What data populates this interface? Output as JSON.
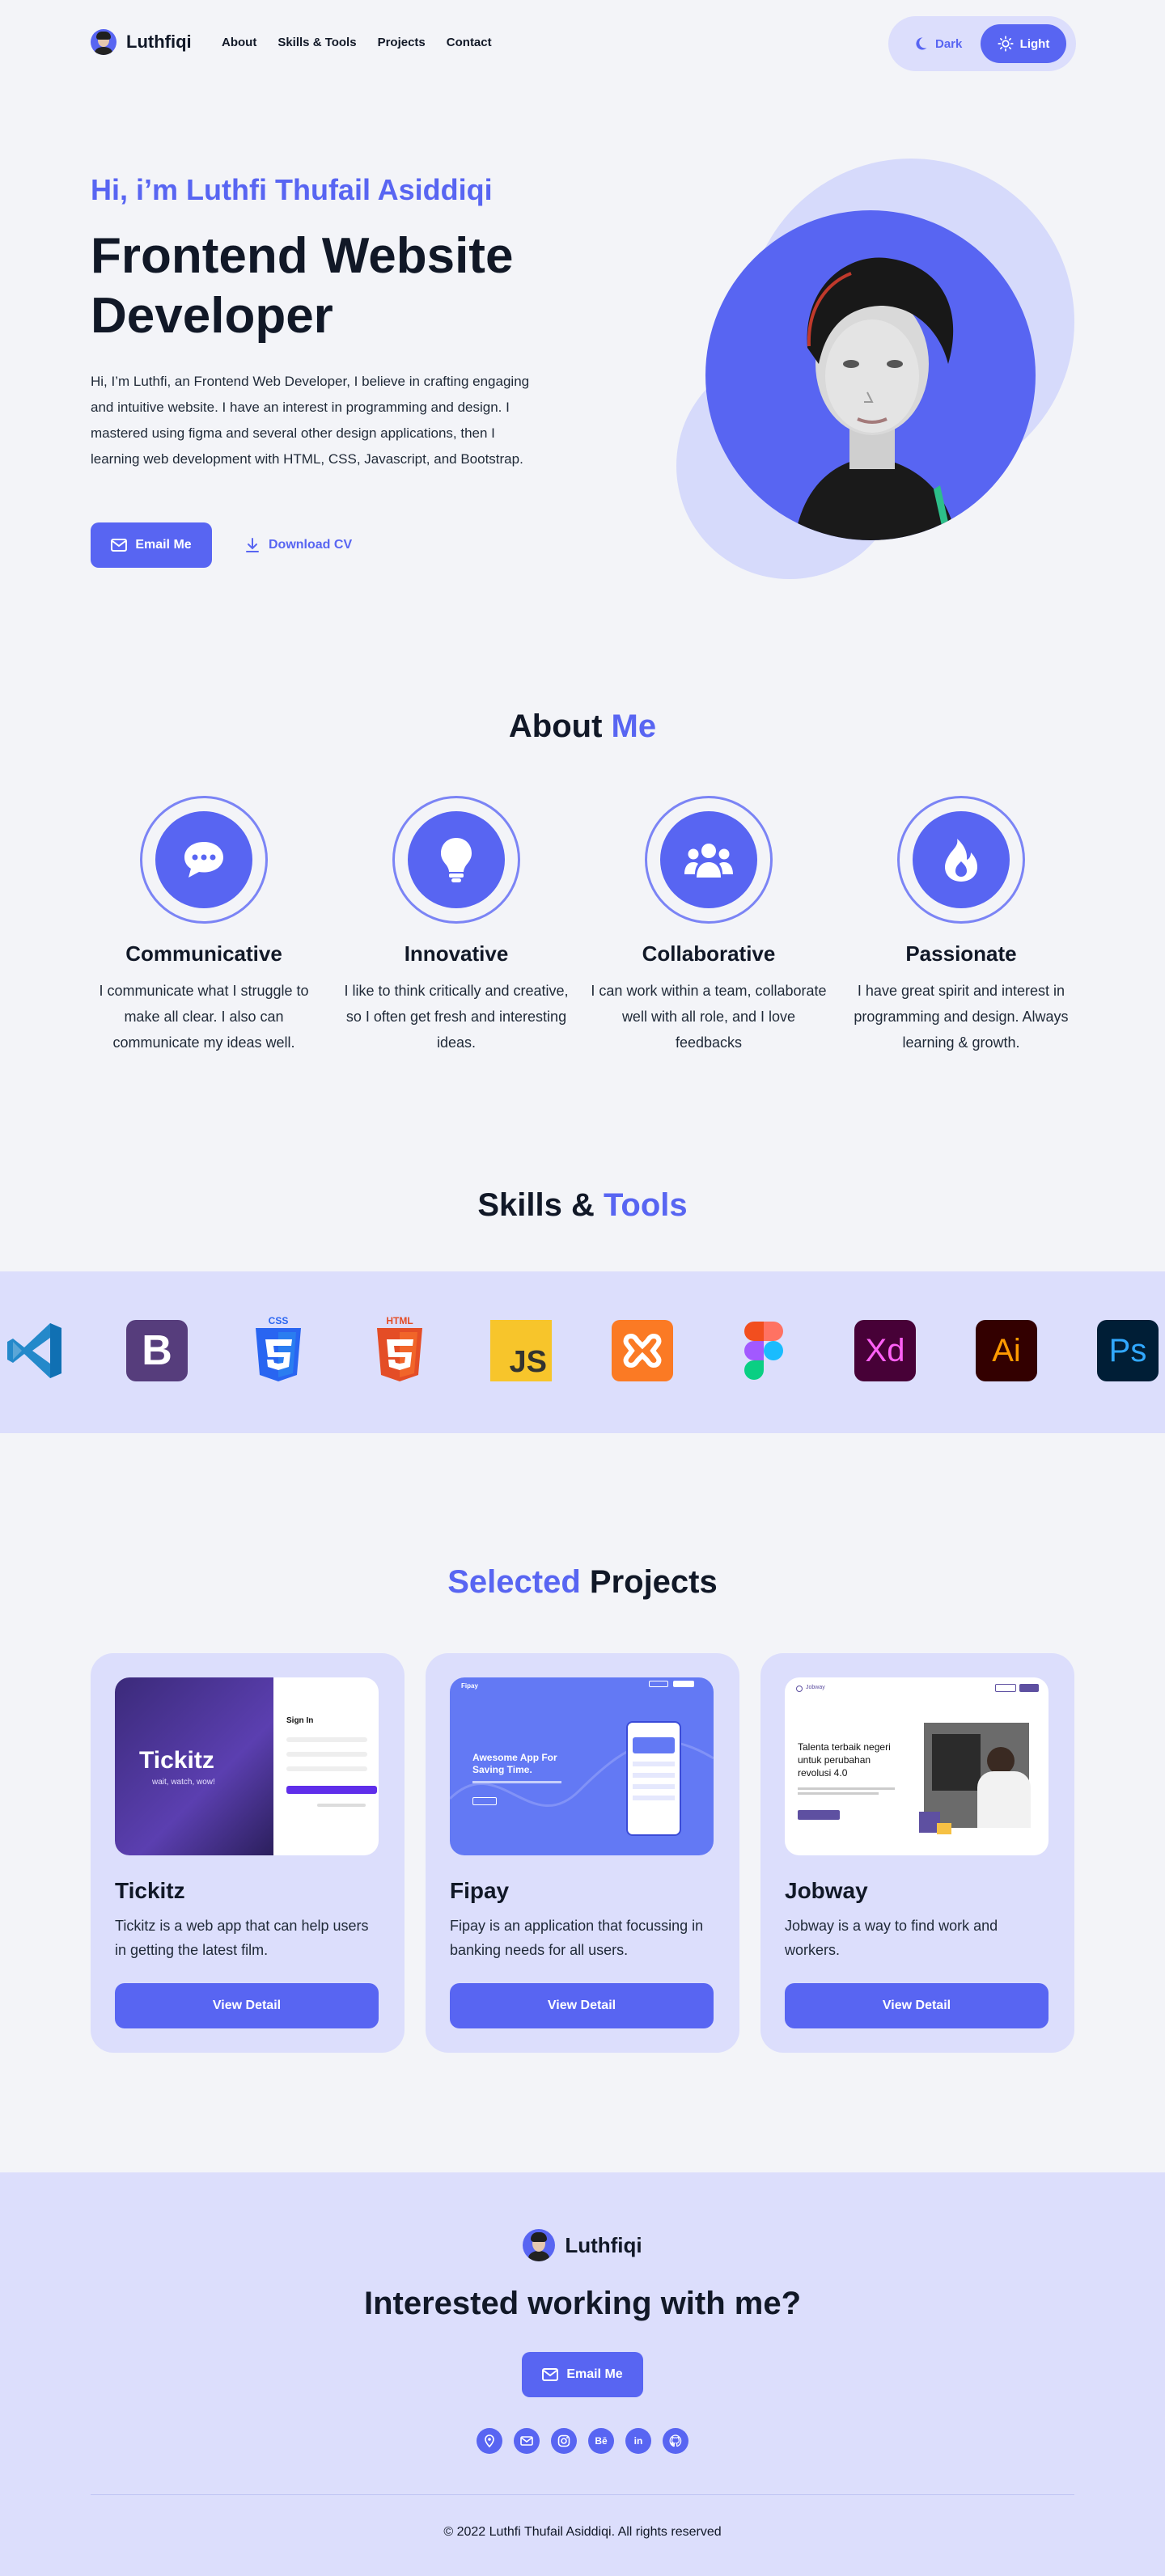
{
  "brand": {
    "name": "Luthfiqi"
  },
  "nav": {
    "links": [
      "About",
      "Skills & Tools",
      "Projects",
      "Contact"
    ],
    "theme": {
      "dark_label": "Dark",
      "light_label": "Light",
      "selected": "Light"
    }
  },
  "hero": {
    "greeting": "Hi, i’m Luthfi Thufail Asiddiqi",
    "title": "Frontend Website Developer",
    "description": "Hi, I’m Luthfi, an Frontend Web Developer, I believe in crafting engaging and intuitive website. I have an interest in programming and design. I mastered using figma and several other design applications, then I learning web development with HTML, CSS, Javascript, and Bootstrap.",
    "email_button": "Email Me",
    "cv_button": "Download CV"
  },
  "about": {
    "title_main": "About",
    "title_accent": "Me",
    "items": [
      {
        "title": "Communicative",
        "text": "I communicate what I struggle to make all clear. I also can communicate my ideas well.",
        "icon": "chat-icon"
      },
      {
        "title": "Innovative",
        "text": "I like to think critically and creative, so I often get fresh and interesting ideas.",
        "icon": "lightbulb-icon"
      },
      {
        "title": "Collaborative",
        "text": "I can work within a team, collaborate well with all role, and I love feedbacks",
        "icon": "team-icon"
      },
      {
        "title": "Passionate",
        "text": "I have great spirit and interest in programming and design. Always learning & growth.",
        "icon": "flame-icon"
      }
    ]
  },
  "skills": {
    "title_main": "Skills &",
    "title_accent": "Tools",
    "tools": [
      {
        "icon": "vscode-icon",
        "color": "#2489CA"
      },
      {
        "icon": "bootstrap-icon",
        "label": "B",
        "color": "#563D7C"
      },
      {
        "icon": "css3-icon",
        "label": "CSS",
        "color": "#2965F1"
      },
      {
        "icon": "html5-icon",
        "label": "HTML",
        "color": "#E44D26"
      },
      {
        "icon": "javascript-icon",
        "label": "JS",
        "color": "#F7C52B"
      },
      {
        "icon": "xampp-icon",
        "color": "#FB7A24"
      },
      {
        "icon": "figma-icon",
        "color": "#A259FF"
      },
      {
        "icon": "adobe-xd-icon",
        "label": "Xd",
        "color": "#470137"
      },
      {
        "icon": "illustrator-icon",
        "label": "Ai",
        "color": "#330000"
      },
      {
        "icon": "photoshop-icon",
        "label": "Ps",
        "color": "#001E36"
      }
    ]
  },
  "projects": {
    "title_accent": "Selected",
    "title_main": "Projects",
    "items": [
      {
        "name": "Tickitz",
        "description": "Tickitz is a web app that can help users in getting the latest film.",
        "button": "View Detail",
        "thumb": {
          "brand": "Tickitz",
          "tagline": "wait, watch, wow!",
          "form_title": "Sign In"
        }
      },
      {
        "name": "Fipay",
        "description": "Fipay is an application that focussing in banking needs for all users.",
        "button": "View Detail",
        "thumb": {
          "brand": "Fipay",
          "headline": "Awesome App For Saving Time."
        }
      },
      {
        "name": "Jobway",
        "description": "Jobway is a way to find work and workers.",
        "button": "View Detail",
        "thumb": {
          "brand": "Jobway",
          "headline": "Talenta terbaik negeri untuk perubahan revolusi 4.0"
        }
      }
    ]
  },
  "footer": {
    "cta": "Interested working with me?",
    "email_button": "Email Me",
    "socials": [
      "location-icon",
      "mail-icon",
      "instagram-icon",
      "behance-icon",
      "linkedin-icon",
      "github-icon"
    ],
    "copyright": "© 2022 Luthfi Thufail Asiddiqi. All rights reserved"
  },
  "colors": {
    "accent": "#5865F2",
    "soft": "#DCDEFC",
    "background": "#F3F4F8",
    "text": "#111827"
  }
}
